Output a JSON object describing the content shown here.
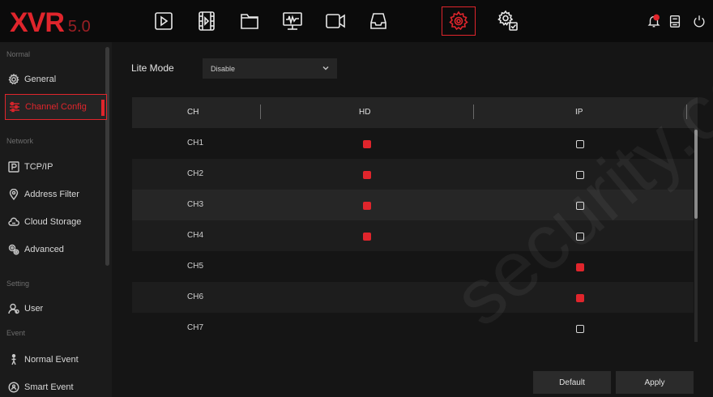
{
  "app": {
    "logo_main": "XVR",
    "logo_version": "5.0"
  },
  "nav": {
    "items": [
      {
        "name": "playback"
      },
      {
        "name": "video-file"
      },
      {
        "name": "file-manager"
      },
      {
        "name": "system-info"
      },
      {
        "name": "record"
      },
      {
        "name": "storage"
      },
      {
        "name": "setting",
        "active": true
      },
      {
        "name": "system-maintenance"
      }
    ],
    "right_icons": [
      "alarm-bell",
      "storage-status",
      "power"
    ]
  },
  "sidebar": {
    "sections": [
      {
        "header": "Normal",
        "items": [
          {
            "label": "General"
          },
          {
            "label": "Channel Config",
            "active": true
          }
        ]
      },
      {
        "header": "Network",
        "items": [
          {
            "label": "TCP/IP"
          },
          {
            "label": "Address Filter"
          },
          {
            "label": "Cloud Storage"
          },
          {
            "label": "Advanced"
          }
        ]
      },
      {
        "header": "Setting",
        "items": [
          {
            "label": "User"
          }
        ]
      },
      {
        "header": "Event",
        "items": [
          {
            "label": "Normal Event"
          },
          {
            "label": "Smart Event"
          }
        ]
      }
    ]
  },
  "lite_mode": {
    "label": "Lite Mode",
    "value": "Disable"
  },
  "table": {
    "headers": [
      "CH",
      "HD",
      "IP"
    ],
    "rows": [
      {
        "ch": "CH1",
        "hd": true,
        "ip": false
      },
      {
        "ch": "CH2",
        "hd": true,
        "ip": false
      },
      {
        "ch": "CH3",
        "hd": true,
        "ip": false
      },
      {
        "ch": "CH4",
        "hd": true,
        "ip": false
      },
      {
        "ch": "CH5",
        "hd": false,
        "ip": true
      },
      {
        "ch": "CH6",
        "hd": false,
        "ip": true
      },
      {
        "ch": "CH7",
        "hd": null,
        "ip": false
      }
    ]
  },
  "buttons": {
    "default": "Default",
    "apply": "Apply"
  },
  "watermark": "security.co",
  "colors": {
    "accent": "#e0252c",
    "background": "#151515",
    "sidebar": "#1b1b1b",
    "topbar": "#0b0b0b"
  }
}
